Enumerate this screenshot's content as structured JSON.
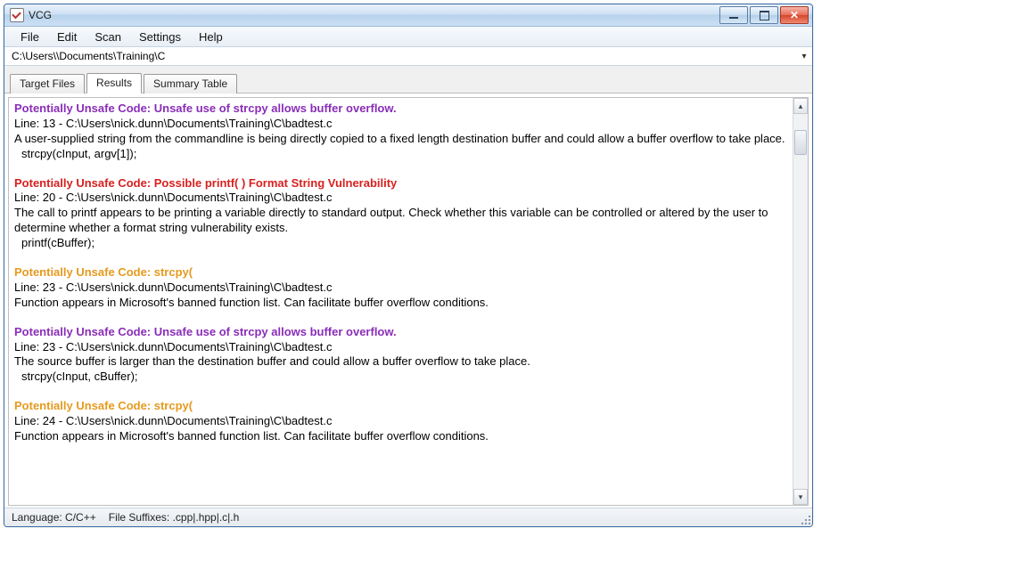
{
  "window": {
    "title": "VCG"
  },
  "menu": {
    "file": "File",
    "edit": "Edit",
    "scan": "Scan",
    "settings": "Settings",
    "help": "Help"
  },
  "path_value": "C:\\Users\\\\Documents\\Training\\C",
  "tabs": {
    "target_files": "Target Files",
    "results": "Results",
    "summary_table": "Summary Table"
  },
  "findings": [
    {
      "color": "purple",
      "title": "Potentially Unsafe Code: Unsafe use of strcpy allows buffer overflow.",
      "line": "Line: 13 - C:\\Users\\nick.dunn\\Documents\\Training\\C\\badtest.c",
      "desc": "A user-supplied string from the commandline is being directly copied to a fixed length destination buffer and could allow a buffer overflow to take place.",
      "code": "strcpy(cInput, argv[1]);"
    },
    {
      "color": "red",
      "title": "Potentially Unsafe Code: Possible printf( ) Format String Vulnerability",
      "line": "Line: 20 - C:\\Users\\nick.dunn\\Documents\\Training\\C\\badtest.c",
      "desc": "The call to printf appears to be printing a variable directly to standard output. Check whether this variable can be controlled or altered by the user to determine whether a format string vulnerability exists.",
      "code": "printf(cBuffer);"
    },
    {
      "color": "orange",
      "title": "Potentially Unsafe Code: strcpy(",
      "line": "Line: 23 - C:\\Users\\nick.dunn\\Documents\\Training\\C\\badtest.c",
      "desc": "Function appears in Microsoft's banned function list. Can facilitate buffer overflow conditions.",
      "code": ""
    },
    {
      "color": "purple",
      "title": "Potentially Unsafe Code: Unsafe use of strcpy allows buffer overflow.",
      "line": "Line: 23 - C:\\Users\\nick.dunn\\Documents\\Training\\C\\badtest.c",
      "desc": "The source buffer is larger than the destination buffer and could allow a buffer overflow to take place.",
      "code": "strcpy(cInput, cBuffer);"
    },
    {
      "color": "orange",
      "title": "Potentially Unsafe Code: strcpy(",
      "line": "Line: 24 - C:\\Users\\nick.dunn\\Documents\\Training\\C\\badtest.c",
      "desc": "Function appears in Microsoft's banned function list. Can facilitate buffer overflow conditions.",
      "code": ""
    }
  ],
  "status": {
    "language": "Language: C/C++",
    "suffixes": "File Suffixes: .cpp|.hpp|.c|.h"
  }
}
